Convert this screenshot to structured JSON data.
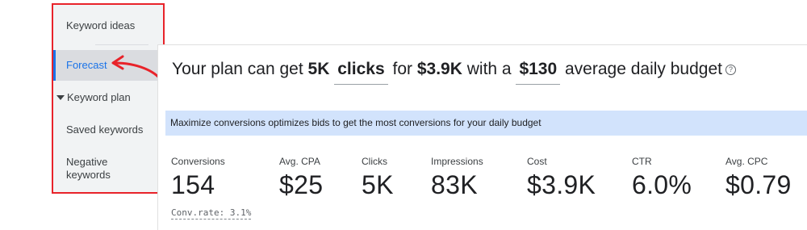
{
  "sidebar": {
    "keyword_ideas": "Keyword ideas",
    "forecast": "Forecast",
    "keyword_plan": "Keyword plan",
    "saved_keywords": "Saved keywords",
    "negative_keywords_line1": "Negative",
    "negative_keywords_line2": "keywords"
  },
  "headline": {
    "part1": "Your plan can get",
    "clicks_value": "5K",
    "clicks_metric": "clicks",
    "part2": "for",
    "cost": "$3.9K",
    "part3": "with a",
    "budget": "$130",
    "part4": "average daily budget"
  },
  "banner": {
    "text": "Maximize conversions optimizes bids to get the most conversions for your daily budget"
  },
  "metrics": [
    {
      "label": "Conversions",
      "value": "154"
    },
    {
      "label": "Avg. CPA",
      "value": "$25"
    },
    {
      "label": "Clicks",
      "value": "5K"
    },
    {
      "label": "Impressions",
      "value": "83K"
    },
    {
      "label": "Cost",
      "value": "$3.9K"
    },
    {
      "label": "CTR",
      "value": "6.0%"
    },
    {
      "label": "Avg. CPC",
      "value": "$0.79"
    }
  ],
  "conv_rate": "Conv.rate: 3.1%",
  "colors": {
    "highlight_border": "#e8232a",
    "accent": "#1a73e8",
    "banner_bg": "#d2e3fc"
  },
  "icons": {
    "help": "help-circle-icon",
    "caret": "caret-down-icon",
    "arrow": "curved-arrow-annotation"
  }
}
